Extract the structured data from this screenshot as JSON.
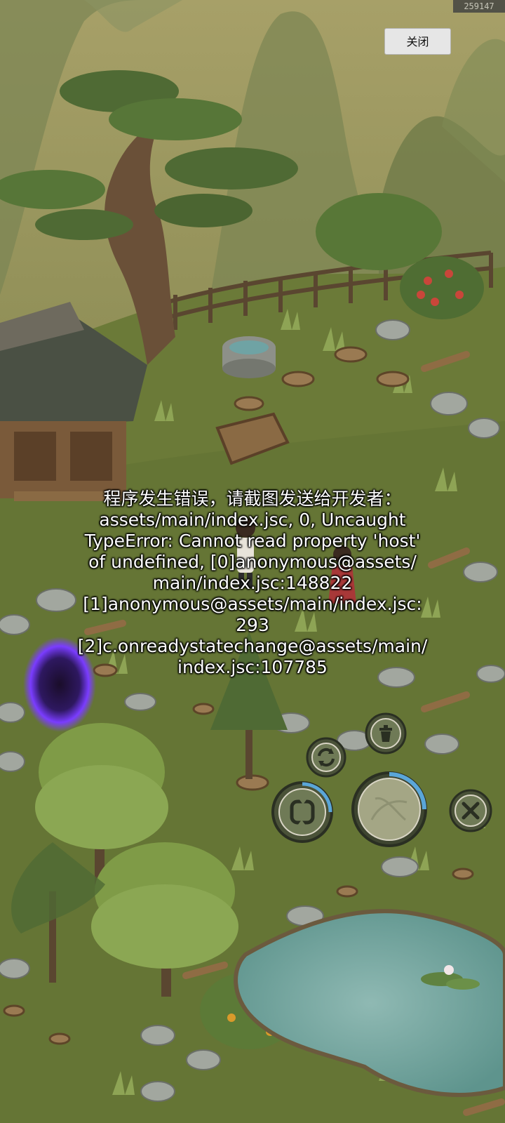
{
  "build_id": "259147",
  "close_label": "关闭",
  "error_lines": [
    "程序发生错误，请截图发送给开发者：",
    "assets/main/index.jsc, 0, Uncaught",
    "TypeError: Cannot read property 'host'",
    "of undefined, [0]anonymous@assets/",
    "main/index.jsc:148822",
    "[1]anonymous@assets/main/index.jsc:",
    "293",
    "[2]c.onreadystatechange@assets/main/",
    "index.jsc:107785"
  ],
  "controls": {
    "refresh_icon": "refresh-icon",
    "trash_icon": "trash-icon",
    "swap_icon": "swap-icon",
    "action_icon": "action-icon",
    "cancel_icon": "cancel-icon"
  }
}
